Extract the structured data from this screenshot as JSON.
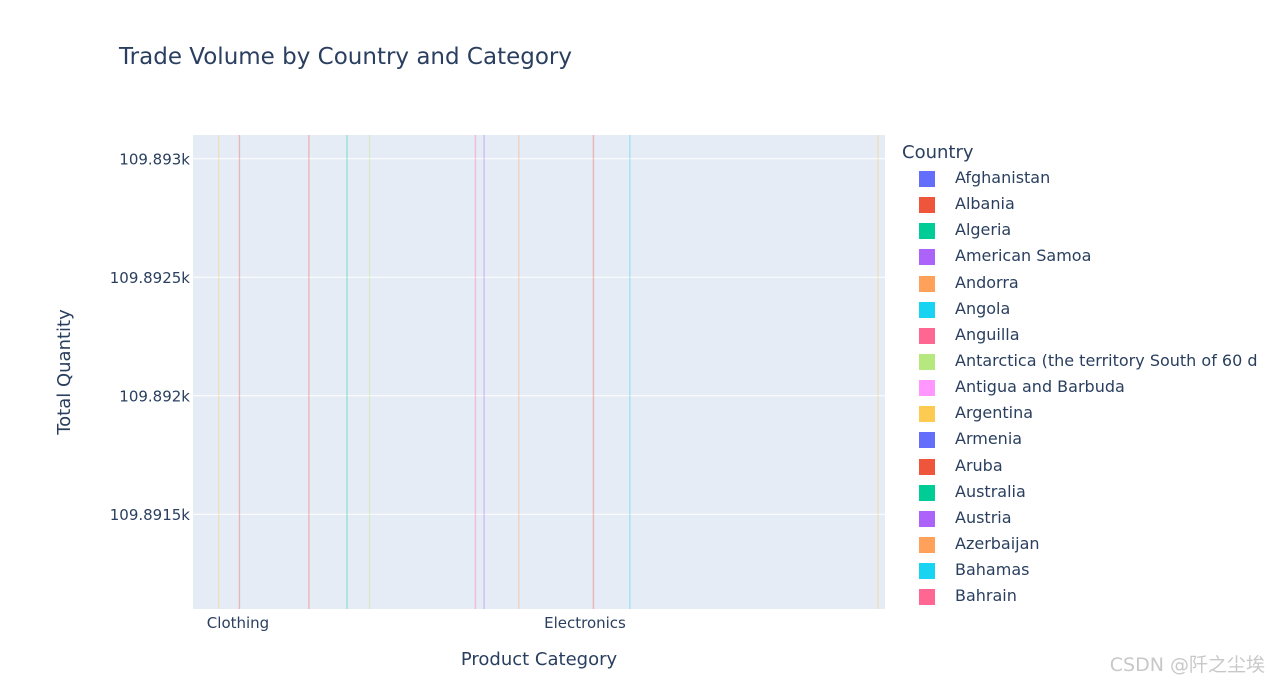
{
  "chart_data": {
    "type": "bar",
    "title": "Trade Volume by Country and Category",
    "xlabel": "Product Category",
    "ylabel": "Total Quantity",
    "categories": [
      "Clothing",
      "Electronics"
    ],
    "y_ticks": [
      "109.8915k",
      "109.892k",
      "109.8925k",
      "109.893k"
    ],
    "y_tick_values": [
      109891.5,
      109892,
      109892.5,
      109893
    ],
    "ylim": [
      109891.1,
      109893.1
    ],
    "grid": true,
    "legend_placement": "right",
    "legend": {
      "title": "Country",
      "entries": [
        {
          "name": "Afghanistan",
          "color": "#636efa"
        },
        {
          "name": "Albania",
          "color": "#EF553B"
        },
        {
          "name": "Algeria",
          "color": "#00cc96"
        },
        {
          "name": "American Samoa",
          "color": "#ab63fa"
        },
        {
          "name": "Andorra",
          "color": "#FFA15A"
        },
        {
          "name": "Angola",
          "color": "#19d3f3"
        },
        {
          "name": "Anguilla",
          "color": "#FF6692"
        },
        {
          "name": "Antarctica (the territory South of 60 d",
          "color": "#B6E880"
        },
        {
          "name": "Antigua and Barbuda",
          "color": "#FF97FF"
        },
        {
          "name": "Argentina",
          "color": "#FECB52"
        },
        {
          "name": "Armenia",
          "color": "#636efa"
        },
        {
          "name": "Aruba",
          "color": "#EF553B"
        },
        {
          "name": "Australia",
          "color": "#00cc96"
        },
        {
          "name": "Austria",
          "color": "#ab63fa"
        },
        {
          "name": "Azerbaijan",
          "color": "#FFA15A"
        },
        {
          "name": "Bahamas",
          "color": "#19d3f3"
        },
        {
          "name": "Bahrain",
          "color": "#FF6692"
        }
      ]
    },
    "bars": [
      {
        "category_offset": 0.02,
        "color": "#FECB52"
      },
      {
        "category_offset": 0.08,
        "color": "#EF553B"
      },
      {
        "category_offset": 0.28,
        "color": "#EF553B"
      },
      {
        "category_offset": 0.39,
        "color": "#00cc96"
      },
      {
        "category_offset": 0.455,
        "color": "#B6E880"
      },
      {
        "category_offset": 0.76,
        "color": "#FF6692"
      },
      {
        "category_offset": 0.785,
        "color": "#ab63fa"
      },
      {
        "category_offset": 0.885,
        "color": "#FFA15A"
      },
      {
        "category_offset": 1.1,
        "color": "#EF553B"
      },
      {
        "category_offset": 1.205,
        "color": "#19d3f3"
      },
      {
        "category_offset": 1.92,
        "color": "#FECB52"
      }
    ]
  },
  "watermark": "CSDN @阡之尘埃"
}
